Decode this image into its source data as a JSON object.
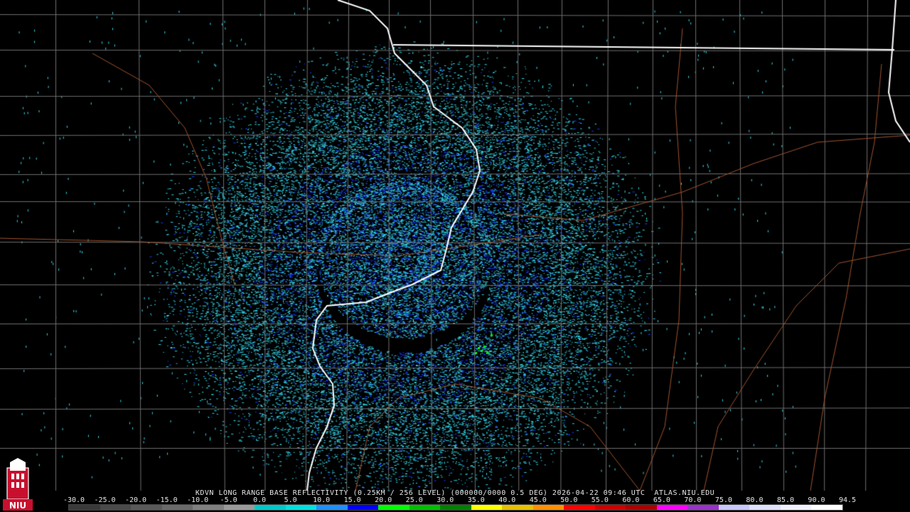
{
  "caption": "KDVN LONG RANGE BASE REFLECTIVITY (0.25KM / 256 LEVEL) (000000/0000 0.5 DEG) 2026-04-22 09:46 UTC  ATLAS.NIU.EDU",
  "logo_text": "NIU",
  "scale": {
    "labels": [
      "-30.0",
      "-25.0",
      "-20.0",
      "-15.0",
      "-10.0",
      "-5.0",
      "0.0",
      "5.0",
      "10.0",
      "15.0",
      "20.0",
      "25.0",
      "30.0",
      "35.0",
      "40.0",
      "45.0",
      "50.0",
      "55.0",
      "60.0",
      "65.0",
      "70.0",
      "75.0",
      "80.0",
      "85.0",
      "90.0",
      "94.5"
    ],
    "colors": [
      "#3a3a3a",
      "#4a4a4a",
      "#5a5a5a",
      "#6a6a6a",
      "#808080",
      "#9a9a9a",
      "#00c8c8",
      "#00e0e0",
      "#1e90ff",
      "#0000ff",
      "#00ff00",
      "#00c000",
      "#008000",
      "#ffff00",
      "#e6c000",
      "#ff9000",
      "#ff0000",
      "#d00000",
      "#b00000",
      "#ff00ff",
      "#9932cc",
      "#c8c8ff",
      "#e0e0ff",
      "#f0f0ff",
      "#ffffff"
    ]
  },
  "colors": {
    "background": "#000000",
    "county_lines": "#6e6e6e",
    "state_lines": "#ffffff",
    "highways": "#a0522d",
    "echo_light": "#33d6e6",
    "echo_dark": "#1a3cff",
    "echo_green": "#00ff00"
  }
}
